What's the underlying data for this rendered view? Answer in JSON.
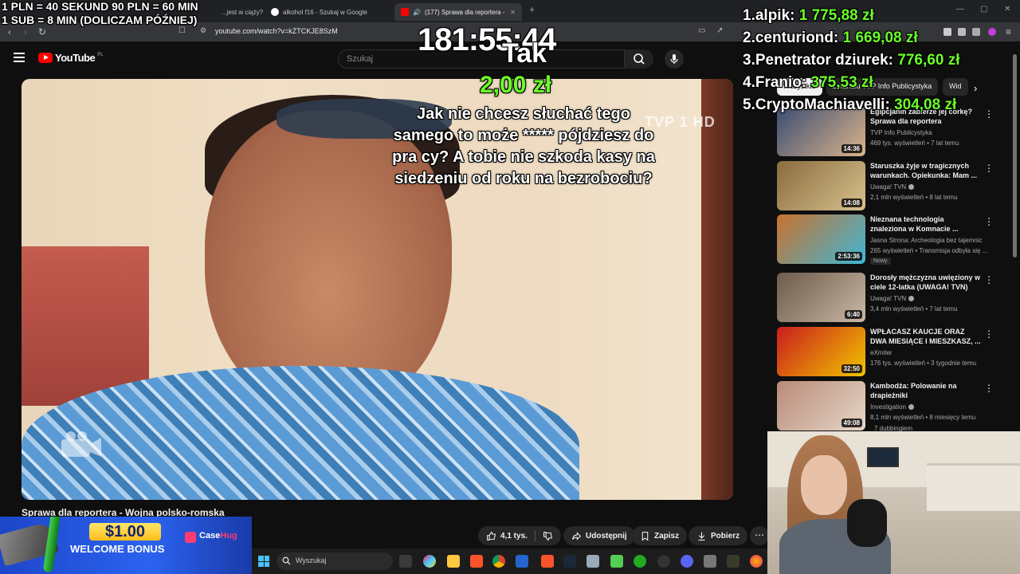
{
  "browser": {
    "tabs": [
      {
        "label": "...jest w ciąży?",
        "active": false
      },
      {
        "label": "alkohol f16 - Szukaj w Google",
        "active": false
      },
      {
        "label": "(177) Sprawa dla reportera -",
        "active": true
      }
    ],
    "url": "youtube.com/watch?v=kZTCKJE8SzM"
  },
  "youtube": {
    "logo": "YouTube",
    "country": "PL",
    "search_placeholder": "Szukaj",
    "video_title": "Sprawa dla reportera - Wojna polsko-romska",
    "tv_logo": "TVP 1 HD",
    "actions": {
      "likes": "4,1 tys.",
      "share": "Udostępnij",
      "save": "Zapisz",
      "download": "Pobierz"
    },
    "chips": [
      "Wszystkie",
      "Z kanału TVP Info Publicystyka",
      "Wid"
    ],
    "recommendations": [
      {
        "title": "Egipcjanin zabierze jej córkę? Sprawa dla reportera",
        "channel": "TVP Info Publicystyka",
        "meta": "469 tys. wyświetleń • 7 lat temu",
        "duration": "14:36",
        "verified": false,
        "badge": "",
        "thumb": [
          "#3b4d73",
          "#d9b48a"
        ]
      },
      {
        "title": "Staruszka żyje w tragicznych warunkach. Opiekunka: Mam ...",
        "channel": "Uwaga! TVN",
        "meta": "2,1 mln wyświetleń • 8 lat temu",
        "duration": "14:08",
        "verified": true,
        "badge": "",
        "thumb": [
          "#8a6b3d",
          "#d8c28f"
        ]
      },
      {
        "title": "Nieznana technologia znaleziona w Komnacie ...",
        "channel": "Jasna Strona: Archeologia bez tajemnic",
        "meta": "265 wyświetleń • Transmisja odbyła się ...",
        "duration": "2:53:36",
        "verified": false,
        "badge": "Nowy",
        "thumb": [
          "#c9712d",
          "#3fb7d6"
        ]
      },
      {
        "title": "Dorosły mężczyzna uwięziony w ciele 12-latka (UWAGA! TVN)",
        "channel": "Uwaga! TVN",
        "meta": "3,4 mln wyświetleń • 7 lat temu",
        "duration": "6:40",
        "verified": true,
        "badge": "",
        "thumb": [
          "#6c5a4a",
          "#cbb9a6"
        ]
      },
      {
        "title": "WPŁACASZ KAUCJE ORAZ DWA MIESIĄCE I MIESZKASZ, ...",
        "channel": "eXmiter",
        "meta": "176 tys. wyświetleń • 3 tygodnie temu",
        "duration": "32:50",
        "verified": false,
        "badge": "",
        "thumb": [
          "#c81d1d",
          "#f2c500"
        ]
      },
      {
        "title": "Kambodża: Polowanie na drapieżniki",
        "channel": "Investigation",
        "meta": "8,1 mln wyświetleń • 8 miesięcy temu",
        "duration": "49:08",
        "verified": true,
        "badge": "",
        "thumb": [
          "#b98a78",
          "#e6d7c8"
        ]
      }
    ],
    "dubbing_note": "7 dubbingiem"
  },
  "overlay": {
    "rules_line1": "1 PLN = 40 SEKUND 90 PLN = 60 MIN",
    "rules_line2": "1 SUB = 8 MIN (DOLICZAM PÓŹNIEJ)",
    "timer": "181:55:44",
    "donor": "Tak",
    "amount": "2,00 zł",
    "message": "Jak nie chcesz słuchać tego samego to może ***** pójdziesz do pra cy? A tobie nie szkoda kasy na siedzeniu od roku na bezrobociu?",
    "leaderboard": [
      {
        "rank": "1.",
        "name": "alpik:",
        "amount": "1 775,88 zł"
      },
      {
        "rank": "2.",
        "name": "centuriond:",
        "amount": "1 669,08 zł"
      },
      {
        "rank": "3.",
        "name": "Penetrator dziurek:",
        "amount": "776,60 zł"
      },
      {
        "rank": "4.",
        "name": "Franio:",
        "amount": "375,53 zł"
      },
      {
        "rank": "5.",
        "name": "CryptoMachiavelli:",
        "amount": "304,08 zł"
      }
    ]
  },
  "ad": {
    "price": "$1.00",
    "text": "WELCOME BONUS",
    "brand_a": "Case",
    "brand_b": "Hug"
  },
  "taskbar": {
    "search_placeholder": "Wyszukaj"
  },
  "colors": {
    "donation_green": "#6bff2a",
    "youtube_red": "#ff0000",
    "bg": "#0f0f0f"
  }
}
